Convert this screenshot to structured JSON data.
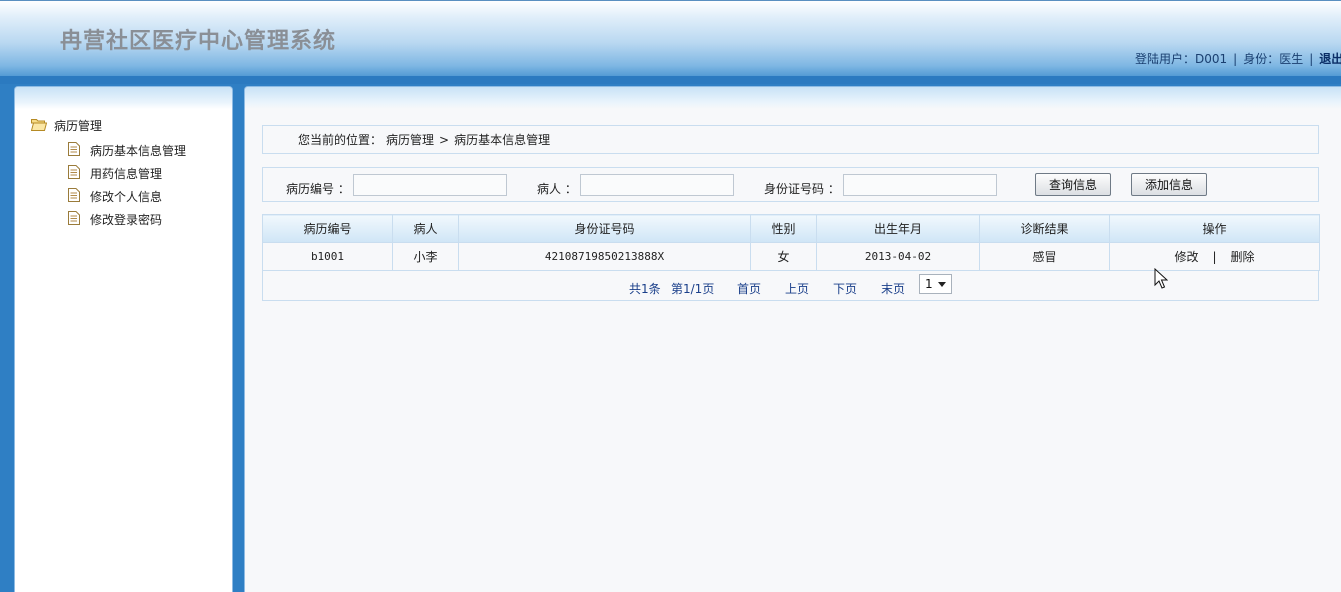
{
  "header": {
    "title": "冉营社区医疗中心管理系统",
    "user_label": "登陆用户：D001",
    "role_label": "身份：医生",
    "separator": "|",
    "logout": "退出"
  },
  "sidebar": {
    "root": {
      "label": "病历管理",
      "icon": "folder-open-icon"
    },
    "items": [
      {
        "label": "病历基本信息管理",
        "icon": "document-icon"
      },
      {
        "label": "用药信息管理",
        "icon": "document-icon"
      },
      {
        "label": "修改个人信息",
        "icon": "document-icon"
      },
      {
        "label": "修改登录密码",
        "icon": "document-icon"
      }
    ]
  },
  "breadcrumb": {
    "prefix": "您当前的位置：",
    "level1": "病历管理",
    "sep": ">",
    "level2": "病历基本信息管理"
  },
  "search": {
    "record_no_label": "病历编号 ：",
    "record_no_value": "",
    "patient_label": "病人 ：",
    "patient_value": "",
    "id_label": "身份证号码 ：",
    "id_value": "",
    "query_button": "查询信息",
    "add_button": "添加信息"
  },
  "table": {
    "columns": [
      "病历编号",
      "病人",
      "身份证号码",
      "性别",
      "出生年月",
      "诊断结果",
      "操作"
    ],
    "rows": [
      {
        "record_no": "b1001",
        "patient": "小李",
        "id_number": "42108719850213888X",
        "gender": "女",
        "birth": "2013-04-02",
        "diagnosis": "感冒",
        "edit": "修改",
        "sep": "|",
        "delete": "删除"
      }
    ]
  },
  "pager": {
    "total": "共1条",
    "page_info": "第1/1页",
    "first": "首页",
    "prev": "上页",
    "next": "下页",
    "last": "末页",
    "selected_page": "1"
  },
  "colors": {
    "background_blue": "#2f7fc4",
    "link_blue": "#1a3f8a",
    "border_light": "#c9ddef"
  }
}
